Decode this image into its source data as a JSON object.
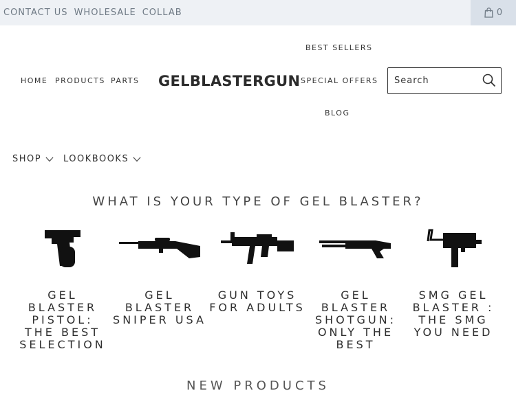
{
  "topbar": {
    "links": [
      "CONTACT US",
      "WHOLESALE",
      "COLLAB"
    ],
    "cart_count": "0"
  },
  "nav": {
    "home": "HOME",
    "products": "PRODUCTS",
    "parts": "PARTS",
    "logo": "GELBLASTERGUN",
    "best_sellers": "BEST SELLERS",
    "special_offers": "SPECIAL OFFERS",
    "blog": "BLOG"
  },
  "search": {
    "placeholder": "Search"
  },
  "menu": {
    "shop": "SHOP",
    "lookbooks": "LOOKBOOKS"
  },
  "section": {
    "heading": "WHAT IS YOUR TYPE OF GEL BLASTER?",
    "categories": [
      {
        "title": "GEL BLASTER PISTOL: THE BEST SELECTION",
        "icon": "pistol-icon"
      },
      {
        "title": "GEL BLASTER SNIPER USA",
        "icon": "sniper-rifle-icon"
      },
      {
        "title": "GUN TOYS FOR ADULTS",
        "icon": "assault-rifle-icon"
      },
      {
        "title": "GEL BLASTER SHOTGUN: ONLY THE BEST",
        "icon": "shotgun-icon"
      },
      {
        "title": "SMG GEL BLASTER : THE SMG YOU NEED",
        "icon": "smg-icon"
      }
    ]
  },
  "new_products": "NEW PRODUCTS"
}
